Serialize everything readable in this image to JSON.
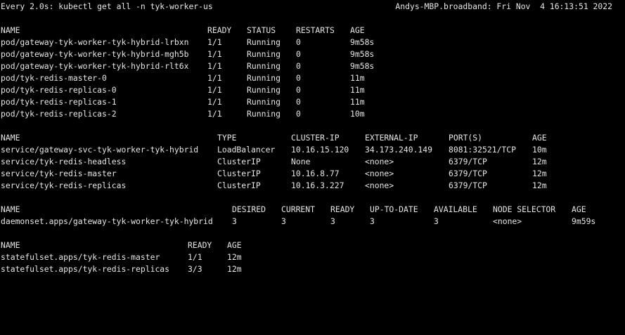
{
  "watch_header": {
    "command": "Every 2.0s: kubectl get all -n tyk-worker-us",
    "host_time": "Andys-MBP.broadband: Fri Nov  4 16:13:51 2022"
  },
  "pods": {
    "columns": [
      "NAME",
      "READY",
      "STATUS",
      "RESTARTS",
      "AGE"
    ],
    "rows": [
      [
        "pod/gateway-tyk-worker-tyk-hybrid-lrbxn",
        "1/1",
        "Running",
        "0",
        "9m58s"
      ],
      [
        "pod/gateway-tyk-worker-tyk-hybrid-mgh5b",
        "1/1",
        "Running",
        "0",
        "9m58s"
      ],
      [
        "pod/gateway-tyk-worker-tyk-hybrid-rlt6x",
        "1/1",
        "Running",
        "0",
        "9m58s"
      ],
      [
        "pod/tyk-redis-master-0",
        "1/1",
        "Running",
        "0",
        "11m"
      ],
      [
        "pod/tyk-redis-replicas-0",
        "1/1",
        "Running",
        "0",
        "11m"
      ],
      [
        "pod/tyk-redis-replicas-1",
        "1/1",
        "Running",
        "0",
        "11m"
      ],
      [
        "pod/tyk-redis-replicas-2",
        "1/1",
        "Running",
        "0",
        "10m"
      ]
    ]
  },
  "services": {
    "columns": [
      "NAME",
      "TYPE",
      "CLUSTER-IP",
      "EXTERNAL-IP",
      "PORT(S)",
      "AGE"
    ],
    "rows": [
      [
        "service/gateway-svc-tyk-worker-tyk-hybrid",
        "LoadBalancer",
        "10.16.15.120",
        "34.173.240.149",
        "8081:32521/TCP",
        "10m"
      ],
      [
        "service/tyk-redis-headless",
        "ClusterIP",
        "None",
        "<none>",
        "6379/TCP",
        "12m"
      ],
      [
        "service/tyk-redis-master",
        "ClusterIP",
        "10.16.8.77",
        "<none>",
        "6379/TCP",
        "12m"
      ],
      [
        "service/tyk-redis-replicas",
        "ClusterIP",
        "10.16.3.227",
        "<none>",
        "6379/TCP",
        "12m"
      ]
    ]
  },
  "daemonsets": {
    "columns": [
      "NAME",
      "DESIRED",
      "CURRENT",
      "READY",
      "UP-TO-DATE",
      "AVAILABLE",
      "NODE SELECTOR",
      "AGE"
    ],
    "rows": [
      [
        "daemonset.apps/gateway-tyk-worker-tyk-hybrid",
        "3",
        "3",
        "3",
        "3",
        "3",
        "<none>",
        "9m59s"
      ]
    ]
  },
  "statefulsets": {
    "columns": [
      "NAME",
      "READY",
      "AGE"
    ],
    "rows": [
      [
        "statefulset.apps/tyk-redis-master",
        "1/1",
        "12m"
      ],
      [
        "statefulset.apps/tyk-redis-replicas",
        "3/3",
        "12m"
      ]
    ]
  }
}
